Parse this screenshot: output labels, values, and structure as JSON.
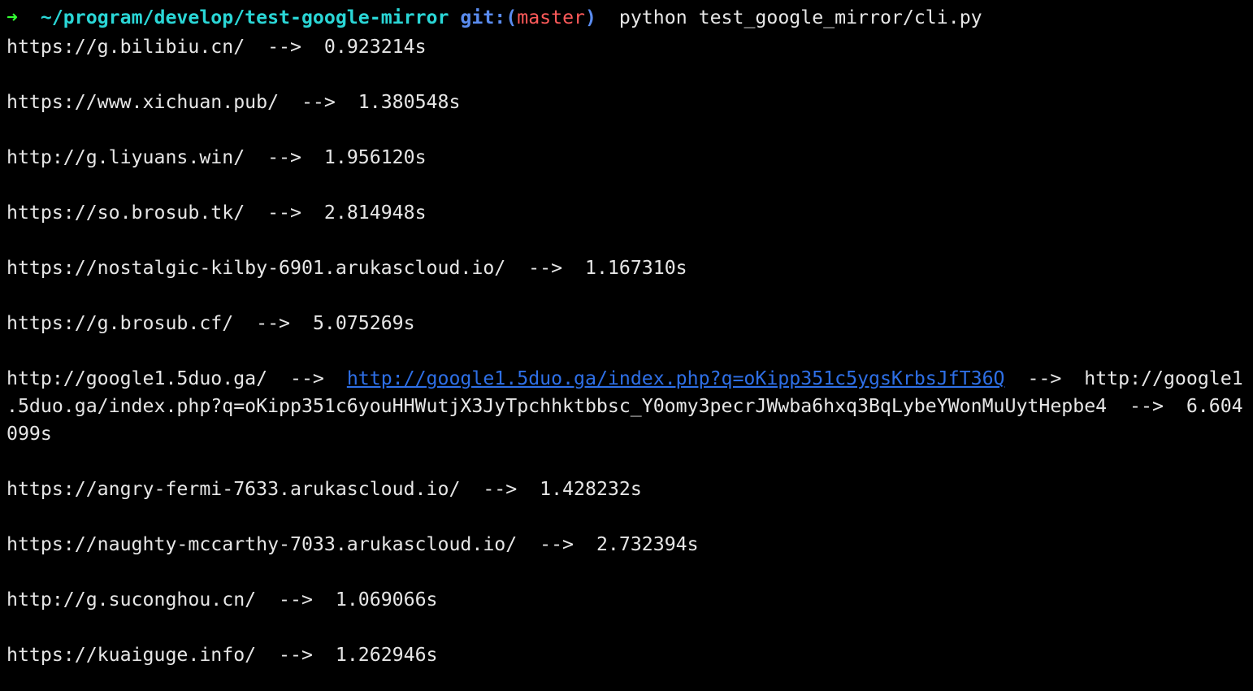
{
  "colors": {
    "background": "#000000",
    "text": "#e6e6e6",
    "prompt_arrow": "#33ff33",
    "cwd": "#2ad6d6",
    "git": "#5a8cf0",
    "branch": "#ff5a5a",
    "link": "#2e6fe6"
  },
  "prompt": {
    "arrow": "➜",
    "cwd": "~/program/develop/test-google-mirror",
    "git_label": "git:(",
    "branch": "master",
    "git_close": ")",
    "command": "python test_google_mirror/cli.py"
  },
  "results": [
    {
      "url": "https://g.bilibiu.cn/",
      "sep": "-->",
      "time": "0.923214s"
    },
    {
      "url": "https://www.xichuan.pub/",
      "sep": "-->",
      "time": "1.380548s"
    },
    {
      "url": "http://g.liyuans.win/",
      "sep": "-->",
      "time": "1.956120s"
    },
    {
      "url": "https://so.brosub.tk/",
      "sep": "-->",
      "time": "2.814948s"
    },
    {
      "url": "https://nostalgic-kilby-6901.arukascloud.io/",
      "sep": "-->",
      "time": "1.167310s"
    },
    {
      "url": "https://g.brosub.cf/",
      "sep": "-->",
      "time": "5.075269s"
    }
  ],
  "redirect": {
    "url": "http://google1.5duo.ga/",
    "sep1": "-->",
    "link": "http://google1.5duo.ga/index.php?q=oKipp351c5ygsKrbsJfT36Q",
    "sep2": "-->",
    "target_part1": "http://google1",
    "line2": ".5duo.ga/index.php?q=oKipp351c6youHHWutjX3JyTpchhktbbsc_Y0omy3pecrJWwba6hxq3BqLybeYWonMuUytHepbe4  -->  6.604",
    "line3": "099s"
  },
  "results2": [
    {
      "url": "https://angry-fermi-7633.arukascloud.io/",
      "sep": "-->",
      "time": "1.428232s"
    },
    {
      "url": "https://naughty-mccarthy-7033.arukascloud.io/",
      "sep": "-->",
      "time": "2.732394s"
    },
    {
      "url": "http://g.suconghou.cn/",
      "sep": "-->",
      "time": "1.069066s"
    },
    {
      "url": "https://kuaiguge.info/",
      "sep": "-->",
      "time": "1.262946s"
    }
  ]
}
